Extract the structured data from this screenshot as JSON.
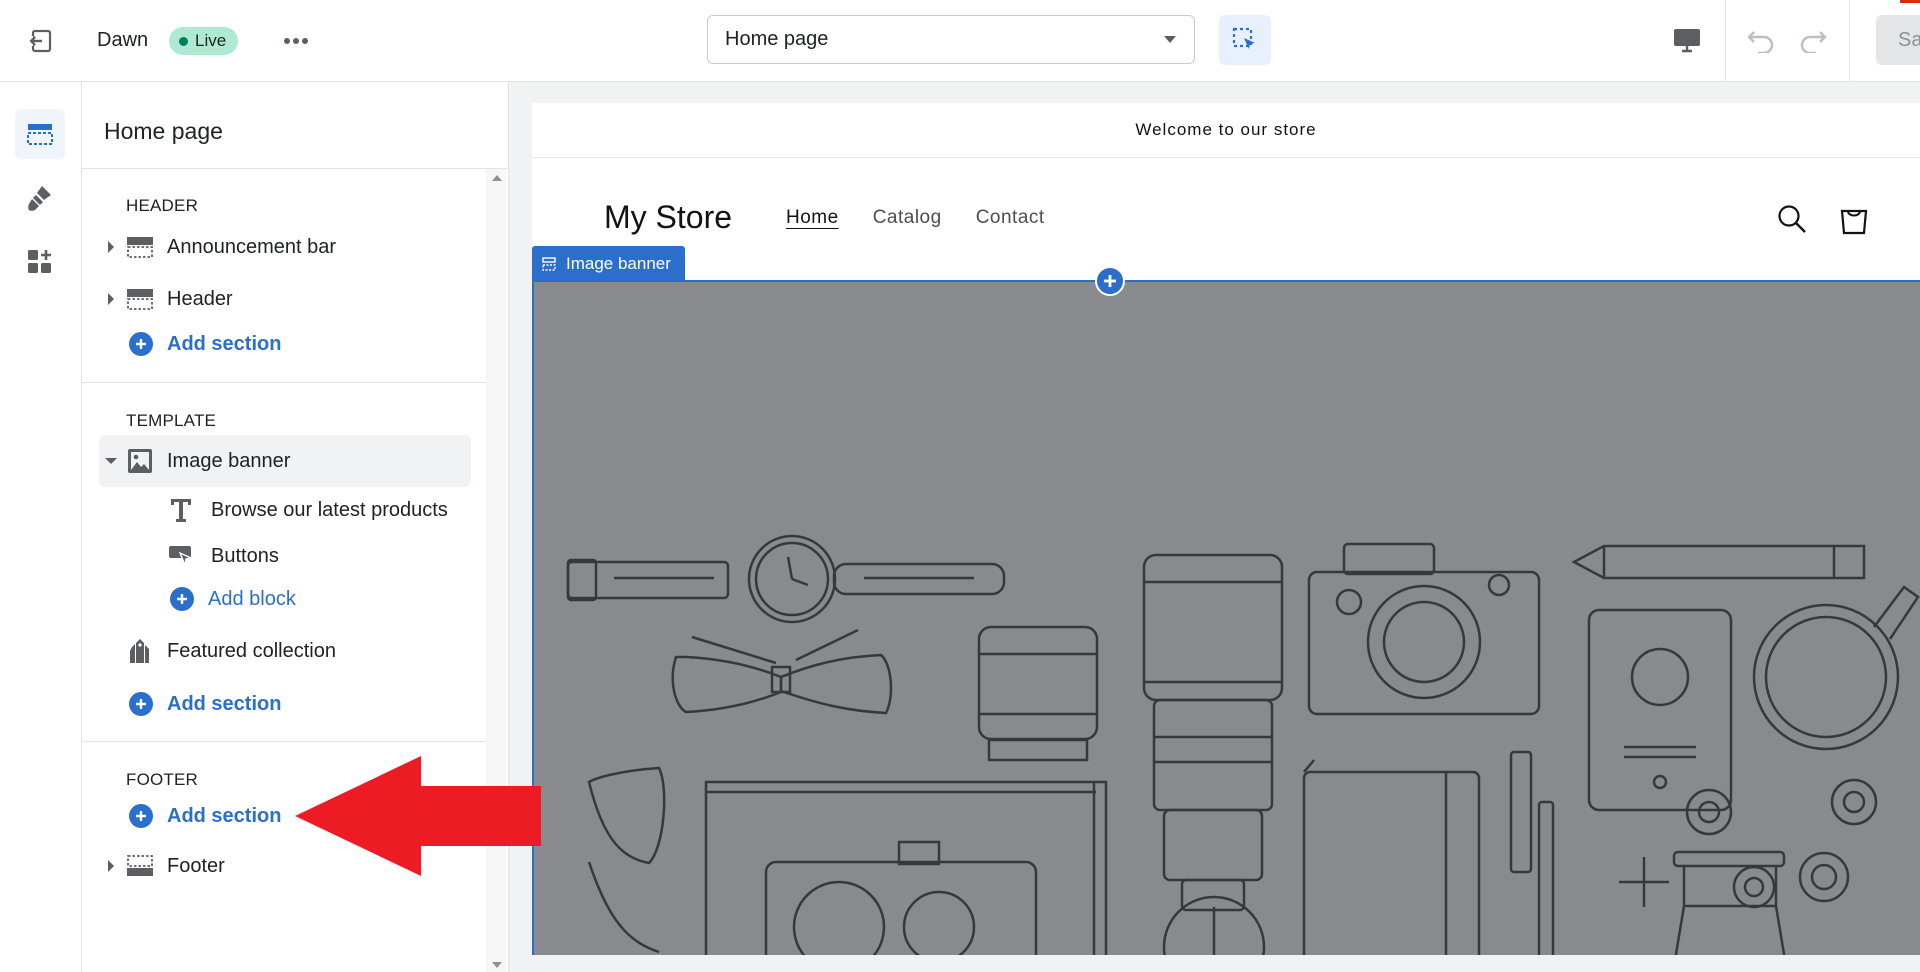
{
  "topbar": {
    "theme_name": "Dawn",
    "live_badge": "Live",
    "page_select": {
      "selected": "Home page"
    },
    "save_label": "Sa"
  },
  "sidebar": {
    "title": "Home page",
    "header_group": {
      "label": "HEADER",
      "items": [
        {
          "label": "Announcement bar",
          "icon": "section-icon"
        },
        {
          "label": "Header",
          "icon": "section-icon"
        }
      ],
      "add_label": "Add section"
    },
    "template_group": {
      "label": "TEMPLATE",
      "image_banner": {
        "label": "Image banner",
        "blocks": [
          {
            "label": "Browse our latest products",
            "icon": "text-icon"
          },
          {
            "label": "Buttons",
            "icon": "buttons-icon"
          }
        ],
        "add_block_label": "Add block"
      },
      "featured_collection": {
        "label": "Featured collection"
      },
      "add_label": "Add section"
    },
    "footer_group": {
      "label": "FOOTER",
      "add_label": "Add section",
      "items": [
        {
          "label": "Footer",
          "icon": "section-icon"
        }
      ]
    }
  },
  "preview": {
    "announcement": "Welcome to our store",
    "store_name": "My Store",
    "nav": [
      "Home",
      "Catalog",
      "Contact"
    ],
    "selected_section_tag": "Image banner"
  },
  "colors": {
    "accent": "#2c6ecb",
    "live_badge": "#aee9d1",
    "banner_bg": "#898a8d",
    "annotation_arrow": "#ed1c24"
  }
}
